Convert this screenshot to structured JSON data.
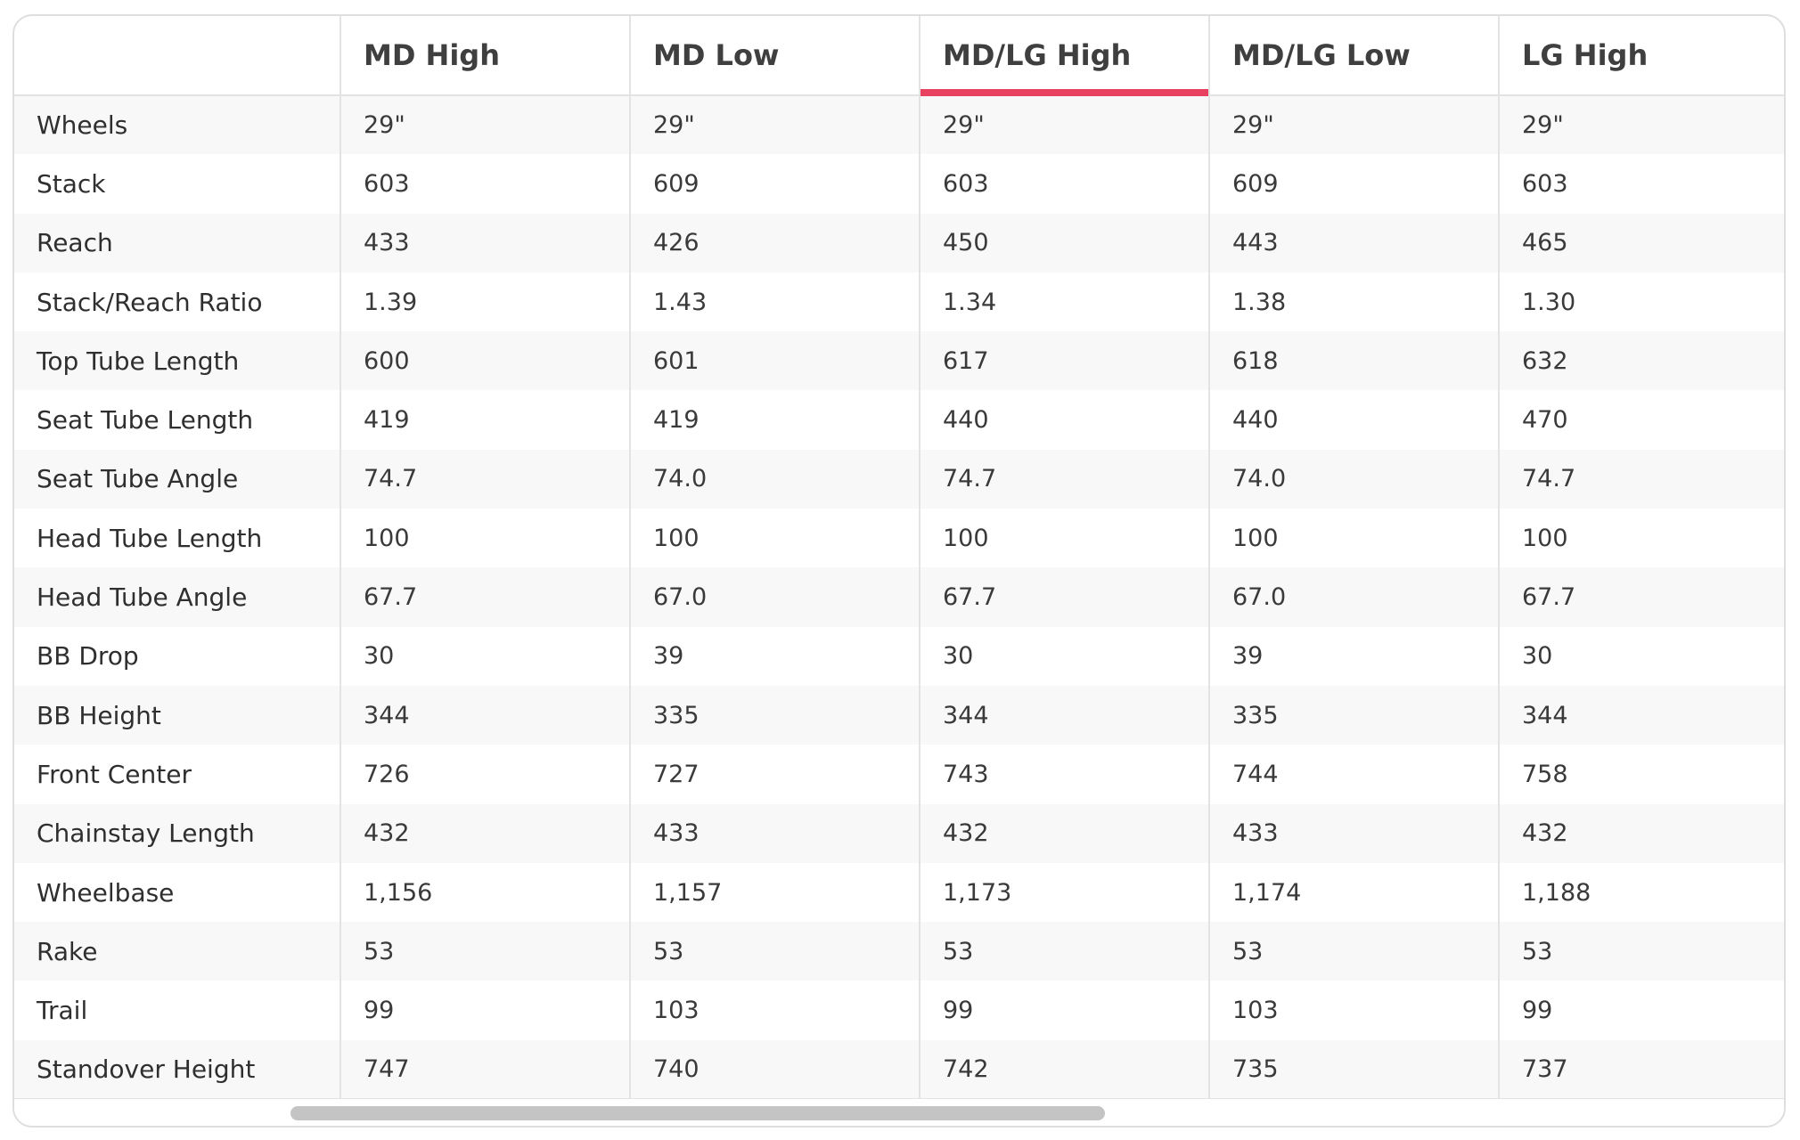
{
  "theme": {
    "accent": "#e8405f"
  },
  "columns": [
    "",
    "MD High",
    "MD Low",
    "MD/LG High",
    "MD/LG Low",
    "LG High"
  ],
  "active_column": "MD/LG High",
  "rows": [
    {
      "label": "Wheels",
      "values": [
        "29\"",
        "29\"",
        "29\"",
        "29\"",
        "29\""
      ]
    },
    {
      "label": "Stack",
      "values": [
        "603",
        "609",
        "603",
        "609",
        "603"
      ]
    },
    {
      "label": "Reach",
      "values": [
        "433",
        "426",
        "450",
        "443",
        "465"
      ]
    },
    {
      "label": "Stack/Reach Ratio",
      "values": [
        "1.39",
        "1.43",
        "1.34",
        "1.38",
        "1.30"
      ]
    },
    {
      "label": "Top Tube Length",
      "values": [
        "600",
        "601",
        "617",
        "618",
        "632"
      ]
    },
    {
      "label": "Seat Tube Length",
      "values": [
        "419",
        "419",
        "440",
        "440",
        "470"
      ]
    },
    {
      "label": "Seat Tube Angle",
      "values": [
        "74.7",
        "74.0",
        "74.7",
        "74.0",
        "74.7"
      ]
    },
    {
      "label": "Head Tube Length",
      "values": [
        "100",
        "100",
        "100",
        "100",
        "100"
      ]
    },
    {
      "label": "Head Tube Angle",
      "values": [
        "67.7",
        "67.0",
        "67.7",
        "67.0",
        "67.7"
      ]
    },
    {
      "label": "BB Drop",
      "values": [
        "30",
        "39",
        "30",
        "39",
        "30"
      ]
    },
    {
      "label": "BB Height",
      "values": [
        "344",
        "335",
        "344",
        "335",
        "344"
      ]
    },
    {
      "label": "Front Center",
      "values": [
        "726",
        "727",
        "743",
        "744",
        "758"
      ]
    },
    {
      "label": "Chainstay Length",
      "values": [
        "432",
        "433",
        "432",
        "433",
        "432"
      ]
    },
    {
      "label": "Wheelbase",
      "values": [
        "1,156",
        "1,157",
        "1,173",
        "1,174",
        "1,188"
      ]
    },
    {
      "label": "Rake",
      "values": [
        "53",
        "53",
        "53",
        "53",
        "53"
      ]
    },
    {
      "label": "Trail",
      "values": [
        "99",
        "103",
        "99",
        "103",
        "99"
      ]
    },
    {
      "label": "Standover Height",
      "values": [
        "747",
        "740",
        "742",
        "735",
        "737"
      ]
    }
  ]
}
